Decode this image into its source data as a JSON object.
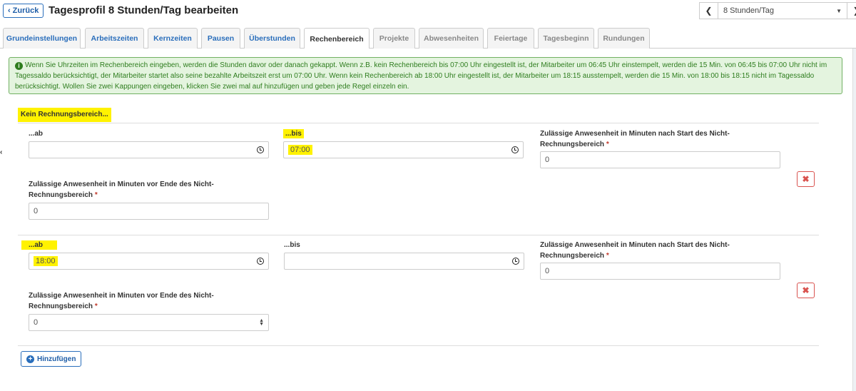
{
  "header": {
    "back_label": "Zurück",
    "title": "Tagesprofil 8 Stunden/Tag bearbeiten",
    "profile_select_value": "8 Stunden/Tag"
  },
  "tabs": [
    {
      "label": "Grundeinstellungen"
    },
    {
      "label": "Arbeitszeiten"
    },
    {
      "label": "Kernzeiten"
    },
    {
      "label": "Pausen"
    },
    {
      "label": "Überstunden"
    },
    {
      "label": "Rechenbereich"
    },
    {
      "label": "Projekte"
    },
    {
      "label": "Abwesenheiten"
    },
    {
      "label": "Feiertage"
    },
    {
      "label": "Tagesbeginn"
    },
    {
      "label": "Rundungen"
    }
  ],
  "info": {
    "text": "Wenn Sie Uhrzeiten im Rechenbereich eingeben, werden die Stunden davor oder danach gekappt. Wenn z.B. kein Rechenbereich bis 07:00 Uhr eingestellt ist, der Mitarbeiter um 06:45 Uhr einstempelt, werden die 15 Min. von 06:45 bis 07:00 Uhr nicht im Tagessaldo berücksichtigt, der Mitarbeiter startet also seine bezahlte Arbeitszeit erst um 07:00 Uhr. Wenn kein Rechenbereich ab 18:00 Uhr eingestellt ist, der Mitarbeiter um 18:15 ausstempelt, werden die 15 Min. von 18:00 bis 18:15 nicht im Tagessaldo berücksichtigt. Wollen Sie zwei Kappungen eingeben, klicken Sie zwei mal auf hinzufügen und geben jede Regel einzeln ein."
  },
  "section": {
    "label": "Kein Rechnungsbereich..."
  },
  "rules": [
    {
      "from_label": "...ab",
      "from_value": "",
      "to_label": "...bis",
      "to_value": "07:00",
      "after_start_label": "Zulässige Anwesenheit in Minuten nach Start des Nicht-Rechnungsbereich",
      "after_start_value": "0",
      "before_end_label": "Zulässige Anwesenheit in Minuten vor Ende des Nicht-Rechnungsbereich",
      "before_end_value": "0",
      "required_mark": "*",
      "delete_label": "✖"
    },
    {
      "from_label": "...ab",
      "from_value": "18:00",
      "to_label": "...bis",
      "to_value": "",
      "after_start_label": "Zulässige Anwesenheit in Minuten nach Start des Nicht-Rechnungsbereich",
      "after_start_value": "0",
      "before_end_label": "Zulässige Anwesenheit in Minuten vor Ende des Nicht-Rechnungsbereich",
      "before_end_value": "0",
      "required_mark": "*",
      "delete_label": "✖"
    }
  ],
  "add_button": {
    "label": "Hinzufügen"
  },
  "colors": {
    "highlight": "#fff200",
    "info_bg": "#e4f4df",
    "info_text": "#2e7d1e",
    "link_blue": "#2a6ebb",
    "danger": "#d9534f"
  }
}
